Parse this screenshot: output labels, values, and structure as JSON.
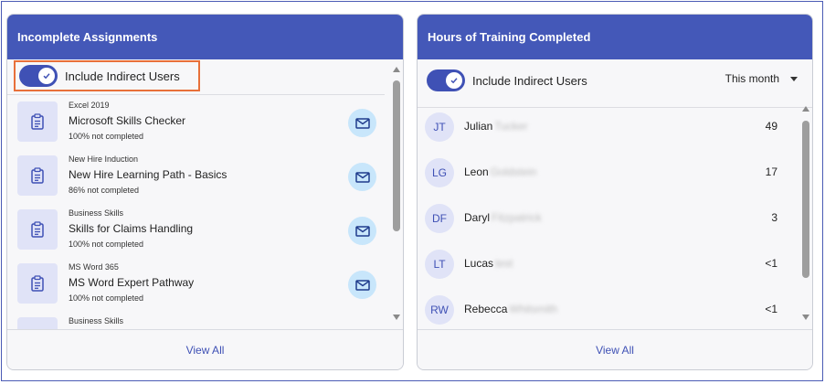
{
  "assignments_card": {
    "title": "Incomplete Assignments",
    "toggle_label": "Include Indirect Users",
    "items": [
      {
        "category": "Excel 2019",
        "title": "Microsoft Skills Checker",
        "status": "100% not completed"
      },
      {
        "category": "New Hire Induction",
        "title": "New Hire Learning Path - Basics",
        "status": "86% not completed"
      },
      {
        "category": "Business Skills",
        "title": "Skills for Claims Handling",
        "status": "100% not completed"
      },
      {
        "category": "MS Word 365",
        "title": "MS Word Expert Pathway",
        "status": "100% not completed"
      },
      {
        "category": "Business Skills",
        "title": "",
        "status": ""
      }
    ],
    "view_all": "View All"
  },
  "training_card": {
    "title": "Hours of Training Completed",
    "toggle_label": "Include Indirect Users",
    "period": "This month",
    "users": [
      {
        "initials": "JT",
        "first": "Julian",
        "last": "Tucker",
        "hours": "49"
      },
      {
        "initials": "LG",
        "first": "Leon",
        "last": "Goldstein",
        "hours": "17"
      },
      {
        "initials": "DF",
        "first": "Daryl",
        "last": "Fitzpatrick",
        "hours": "3"
      },
      {
        "initials": "LT",
        "first": "Lucas",
        "last": "test",
        "hours": "<1"
      },
      {
        "initials": "RW",
        "first": "Rebecca",
        "last": "Whitsmith",
        "hours": "<1"
      }
    ],
    "view_all": "View All"
  },
  "colors": {
    "header": "#4458b8",
    "accent": "#3f51b5",
    "highlight_border": "#e8703a",
    "mail_bg": "#c8e6fb"
  }
}
